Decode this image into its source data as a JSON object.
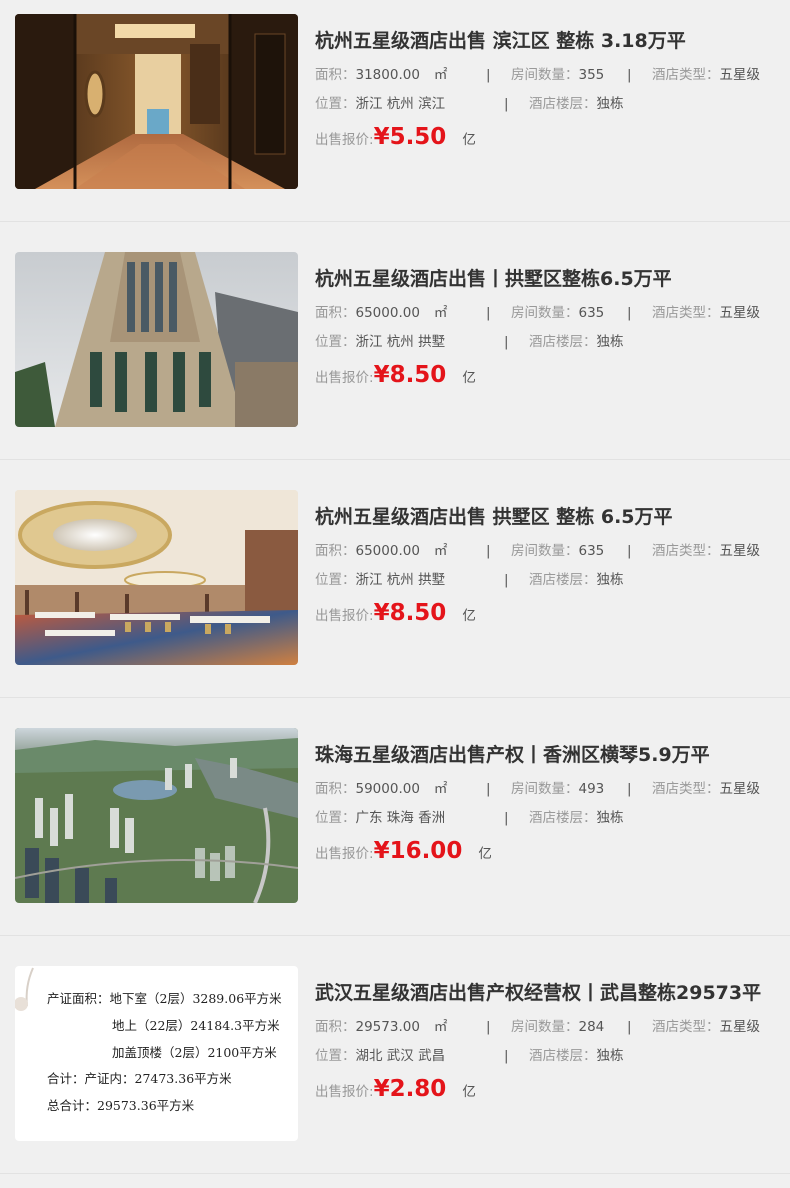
{
  "listings": [
    {
      "title": "杭州五星级酒店出售 滨江区 整栋 3.18万平",
      "area_label": "面积：",
      "area": "31800.00",
      "area_unit": "㎡",
      "rooms_label": "房间数量：",
      "rooms": "355",
      "type_label": "酒店类型：",
      "type": "五星级",
      "location_label": "位置：",
      "location": "浙江 杭州 滨江",
      "floor_label": "酒店楼层：",
      "floor": "独栋",
      "price_label": "出售报价:",
      "price": "¥5.50",
      "price_unit": "亿",
      "image": "hotel-corridor"
    },
    {
      "title": "杭州五星级酒店出售丨拱墅区整栋6.5万平",
      "area_label": "面积：",
      "area": "65000.00",
      "area_unit": "㎡",
      "rooms_label": "房间数量：",
      "rooms": "635",
      "type_label": "酒店类型：",
      "type": "五星级",
      "location_label": "位置：",
      "location": "浙江 杭州 拱墅",
      "floor_label": "酒店楼层：",
      "floor": "独栋",
      "price_label": "出售报价:",
      "price": "¥8.50",
      "price_unit": "亿",
      "image": "hotel-tower"
    },
    {
      "title": "杭州五星级酒店出售 拱墅区 整栋 6.5万平",
      "area_label": "面积：",
      "area": "65000.00",
      "area_unit": "㎡",
      "rooms_label": "房间数量：",
      "rooms": "635",
      "type_label": "酒店类型：",
      "type": "五星级",
      "location_label": "位置：",
      "location": "浙江 杭州 拱墅",
      "floor_label": "酒店楼层：",
      "floor": "独栋",
      "price_label": "出售报价:",
      "price": "¥8.50",
      "price_unit": "亿",
      "image": "banquet-hall"
    },
    {
      "title": "珠海五星级酒店出售产权丨香洲区横琴5.9万平",
      "area_label": "面积：",
      "area": "59000.00",
      "area_unit": "㎡",
      "rooms_label": "房间数量：",
      "rooms": "493",
      "type_label": "酒店类型：",
      "type": "五星级",
      "location_label": "位置：",
      "location": "广东 珠海 香洲",
      "floor_label": "酒店楼层：",
      "floor": "独栋",
      "price_label": "出售报价:",
      "price": "¥16.00",
      "price_unit": "亿",
      "image": "city-aerial"
    },
    {
      "title": "武汉五星级酒店出售产权经营权丨武昌整栋29573平",
      "area_label": "面积：",
      "area": "29573.00",
      "area_unit": "㎡",
      "rooms_label": "房间数量：",
      "rooms": "284",
      "type_label": "酒店类型：",
      "type": "五星级",
      "location_label": "位置：",
      "location": "湖北 武汉 武昌",
      "floor_label": "酒店楼层：",
      "floor": "独栋",
      "price_label": "出售报价:",
      "price": "¥2.80",
      "price_unit": "亿",
      "image": "area-document",
      "document_lines": [
        "产证面积：地下室（2层）3289.06平方米",
        "地上（22层）24184.3平方米",
        "加盖顶楼（2层）2100平方米",
        "合计：产证内：27473.36平方米",
        "总合计：29573.36平方米"
      ]
    }
  ],
  "separator": "|",
  "colors": {
    "price": "#e4141a",
    "background": "#f0f0f0"
  }
}
